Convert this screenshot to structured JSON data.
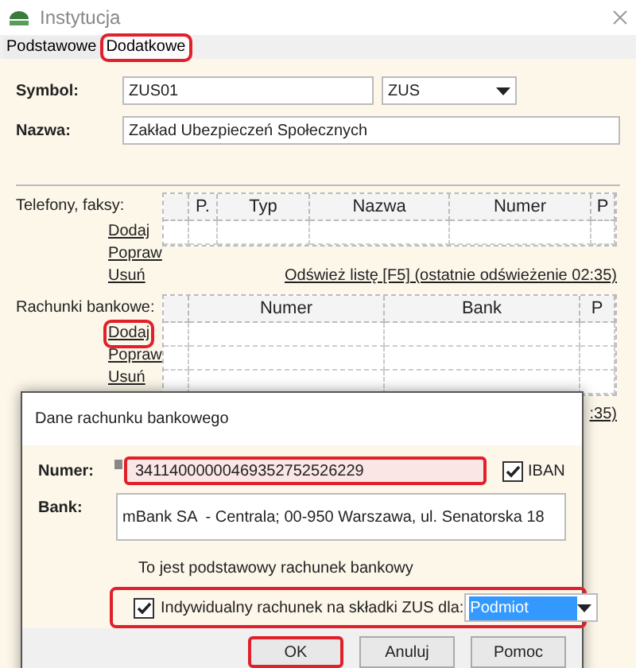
{
  "window": {
    "title": "Instytucja"
  },
  "tabs": [
    {
      "label": "Podstawowe",
      "selected": false,
      "highlighted": false
    },
    {
      "label": "Dodatkowe",
      "selected": true,
      "highlighted": true
    }
  ],
  "symbol": {
    "label": "Symbol:",
    "value": "ZUS01",
    "type_value": "ZUS"
  },
  "name": {
    "label": "Nazwa:",
    "value": "Zakład Ubezpieczeń Społecznych"
  },
  "phones": {
    "label": "Telefony, faksy:",
    "columns": [
      "",
      "P.",
      "Typ",
      "Nazwa",
      "Numer",
      "P"
    ],
    "links": [
      {
        "label": "Dodaj",
        "highlighted": false
      },
      {
        "label": "Popraw",
        "highlighted": false
      },
      {
        "label": "Usuń",
        "highlighted": false
      }
    ],
    "refresh": "Odśwież listę [F5] (ostatnie odświeżenie 02:35)"
  },
  "accounts": {
    "label": "Rachunki bankowe:",
    "columns": [
      "",
      "Numer",
      "Bank",
      "P"
    ],
    "links": [
      {
        "label": "Dodaj",
        "highlighted": true
      },
      {
        "label": "Popraw",
        "highlighted": false
      },
      {
        "label": "Usuń",
        "highlighted": false
      }
    ],
    "refresh_fragment": ":35)"
  },
  "dialog": {
    "title": "Dane rachunku bankowego",
    "number": {
      "label": "Numer:",
      "value": "34114000000469352752526229",
      "highlighted": true
    },
    "iban": {
      "label": "IBAN",
      "checked": true
    },
    "bank": {
      "label": "Bank:",
      "value": "mBank SA  - Centrala; 00-950 Warszawa, ul. Senatorska 18"
    },
    "primary_note": "To jest podstawowy rachunek bankowy",
    "individual": {
      "label": "Indywidualny rachunek na składki ZUS dla:",
      "checked": true,
      "value": "Podmiot",
      "highlighted": true
    },
    "buttons": [
      {
        "label": "OK",
        "highlighted": true
      },
      {
        "label": "Anuluj",
        "highlighted": false
      },
      {
        "label": "Pomoc",
        "highlighted": false
      }
    ]
  }
}
